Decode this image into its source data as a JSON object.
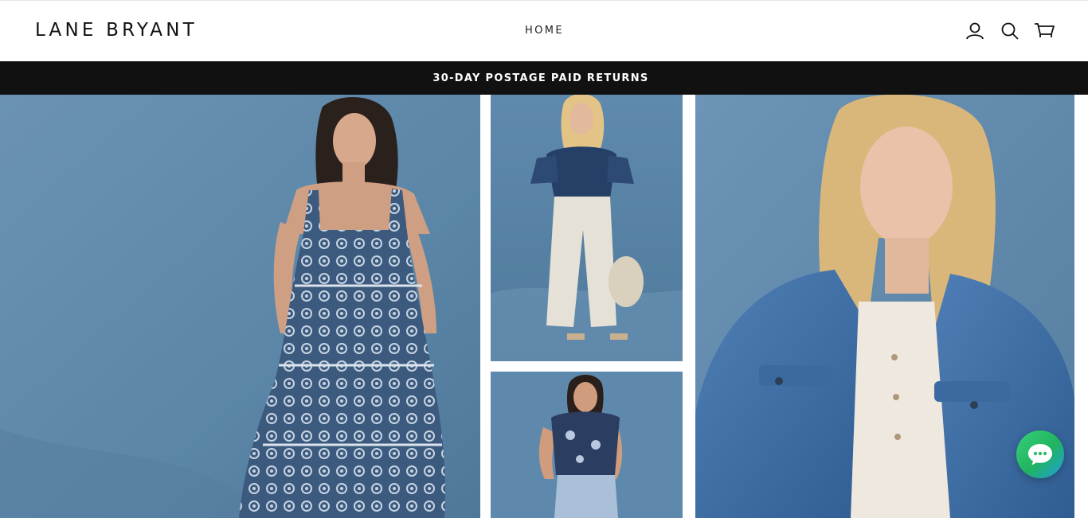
{
  "header": {
    "logo_text": "LANE BRYANT",
    "nav": {
      "home_label": "HOME"
    },
    "icons": [
      "account-icon",
      "search-icon",
      "cart-icon"
    ]
  },
  "announcement": {
    "text": "30-DAY POSTAGE PAID RETURNS"
  },
  "hero": {
    "images": [
      "model-in-blue-printed-sundress",
      "model-in-printed-blouse-and-white-pants",
      "model-in-floral-top-and-jeans",
      "model-in-denim-jacket"
    ]
  },
  "chat": {
    "icon": "chat-bubble-icon"
  },
  "colors": {
    "announcement_bg": "#111111",
    "backdrop_blue": "#5d86a8",
    "chat_green": "#2ec46d"
  }
}
